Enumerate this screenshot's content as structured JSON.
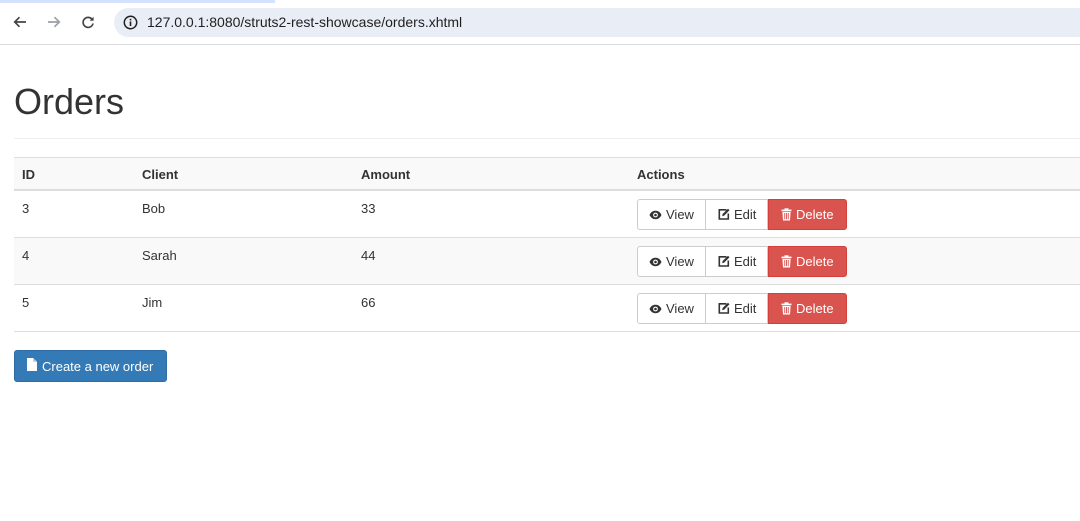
{
  "browser": {
    "url": "127.0.0.1:8080/struts2-rest-showcase/orders.xhtml",
    "icons": {
      "back": "arrow-left-icon",
      "forward": "arrow-right-icon",
      "reload": "reload-icon",
      "site_info": "info-icon"
    }
  },
  "page": {
    "title": "Orders",
    "table": {
      "headers": {
        "id": "ID",
        "client": "Client",
        "amount": "Amount",
        "actions": "Actions"
      },
      "rows": [
        {
          "id": "3",
          "client": "Bob",
          "amount": "33"
        },
        {
          "id": "4",
          "client": "Sarah",
          "amount": "44"
        },
        {
          "id": "5",
          "client": "Jim",
          "amount": "66"
        }
      ]
    },
    "actions": {
      "view": "View",
      "edit": "Edit",
      "delete": "Delete"
    },
    "create_button": "Create a new order"
  },
  "colors": {
    "primary": "#337ab7",
    "danger": "#d9534f",
    "stripe": "#f9f9f9"
  }
}
